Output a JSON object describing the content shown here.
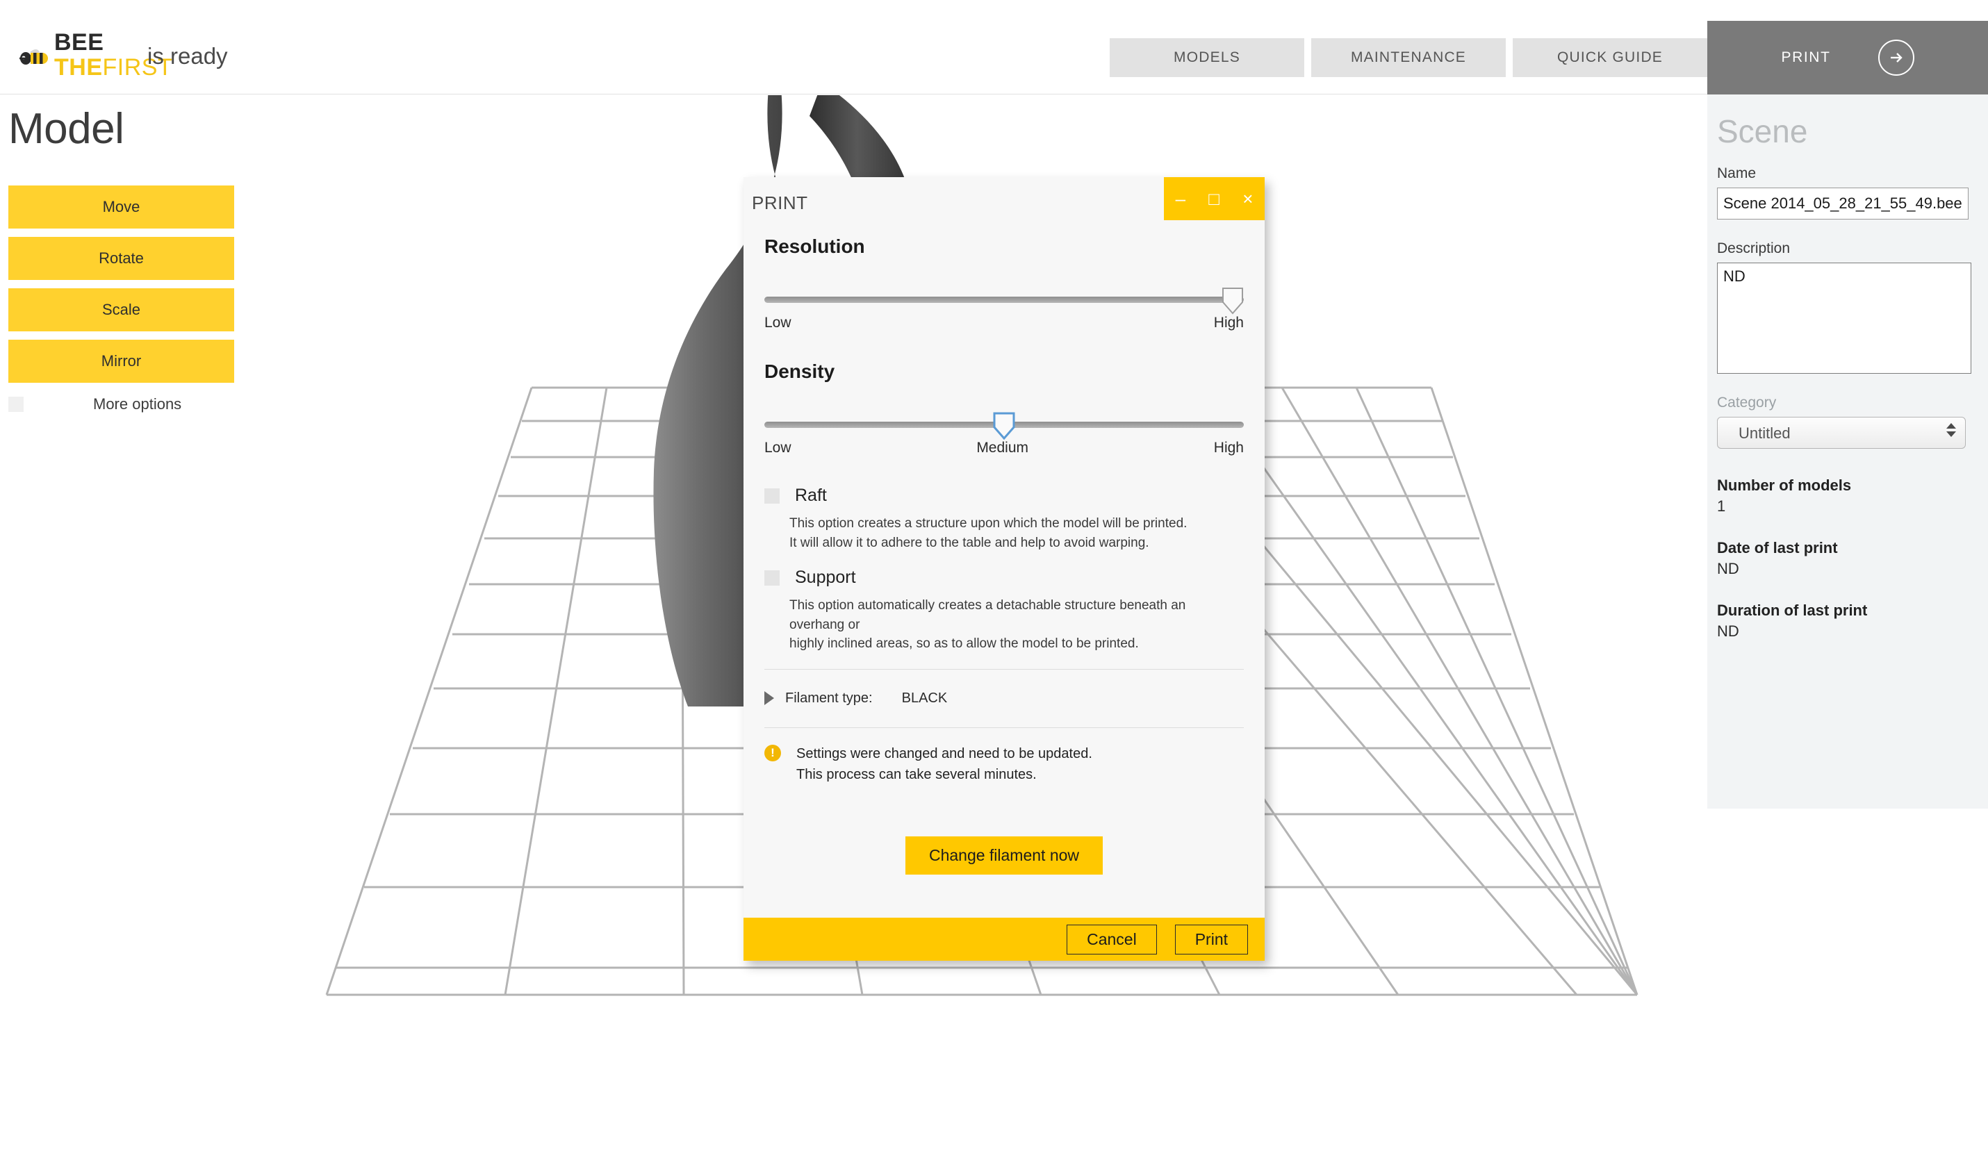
{
  "app": {
    "brand_bee": "BEE",
    "brand_the": "THE",
    "brand_first": "FIRST",
    "status": "is ready"
  },
  "nav": {
    "items": [
      {
        "label": "MODELS"
      },
      {
        "label": "MAINTENANCE"
      },
      {
        "label": "QUICK GUIDE"
      }
    ],
    "cta_label": "PRINT"
  },
  "sidebar": {
    "title": "Model",
    "buttons": [
      {
        "label": "Move"
      },
      {
        "label": "Rotate"
      },
      {
        "label": "Scale"
      },
      {
        "label": "Mirror"
      }
    ],
    "more_options_label": "More options",
    "more_options_checked": false
  },
  "right_panel": {
    "title": "Scene",
    "name_label": "Name",
    "name_value": "Scene 2014_05_28_21_55_49.bee",
    "description_label": "Description",
    "description_value": "ND",
    "category_label": "Category",
    "category_value": "Untitled",
    "category_options": [
      "Untitled"
    ],
    "number_of_models_label": "Number of models",
    "number_of_models_value": "1",
    "date_last_print_label": "Date of last print",
    "date_last_print_value": "ND",
    "duration_last_print_label": "Duration of last print",
    "duration_last_print_value": "ND"
  },
  "dialog": {
    "title": "PRINT",
    "minimize_glyph": "–",
    "maximize_glyph": "□",
    "close_glyph": "×",
    "resolution": {
      "heading": "Resolution",
      "low_label": "Low",
      "high_label": "High",
      "value_percent": 100
    },
    "density": {
      "heading": "Density",
      "low_label": "Low",
      "medium_label": "Medium",
      "high_label": "High",
      "value_percent": 50
    },
    "raft": {
      "label": "Raft",
      "checked": false,
      "description_line1": "This option creates a structure upon which the model will be printed.",
      "description_line2": "It will allow it to adhere to the table and help to avoid warping."
    },
    "support": {
      "label": "Support",
      "checked": false,
      "description_line1": "This option automatically creates a detachable structure beneath an overhang or",
      "description_line2": "highly inclined areas, so as to allow the model to be printed."
    },
    "filament": {
      "label": "Filament type:",
      "value": "BLACK"
    },
    "warning": {
      "icon_glyph": "!",
      "line1": "Settings were changed and need to be updated.",
      "line2": "This process can take several minutes."
    },
    "change_filament_label": "Change filament now",
    "cancel_label": "Cancel",
    "print_label": "Print"
  },
  "colors": {
    "brand_yellow": "#ffd12e",
    "dialog_yellow": "#ffc800",
    "nav_gray": "#e2e2e2",
    "cta_gray": "#7a7a7a",
    "panel_gray": "#f2f4f5",
    "model_gray": "#6e6e6e",
    "grid_line": "#b4b4b4"
  }
}
